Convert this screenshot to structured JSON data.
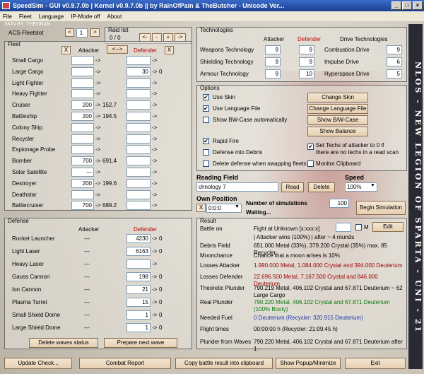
{
  "window": {
    "title": "SpeedSim - GUI v0.9.7.0b | Kernel v0.9.7.0b || by RainOfPain & TheButcher - Unicode Ver..."
  },
  "menu": [
    "File",
    "Fleet",
    "Language",
    "IP-Mode off",
    "About"
  ],
  "skin_label": "SKIN BY: THEORAN",
  "acs": {
    "label": "ACS-Fleetslot",
    "value": "1"
  },
  "raid": {
    "label": "Raid list",
    "value": "0 / 0",
    "btn_prev2": "<-",
    "btn_prev": "-",
    "btn_next": "+",
    "btn_next2": "->"
  },
  "fleet": {
    "title": "Fleet",
    "attacker_label": "Attacker",
    "defender_label": "Defender",
    "swap": "<-->",
    "rows": [
      {
        "name": "Small Cargo",
        "att": "",
        "att_res": "",
        "def": "",
        "def_res": ""
      },
      {
        "name": "Large Cargo",
        "att": "",
        "att_res": "",
        "def": "30",
        "def_res": "0"
      },
      {
        "name": "Light Fighter",
        "att": "",
        "att_res": "",
        "def": "",
        "def_res": ""
      },
      {
        "name": "Heavy Fighter",
        "att": "",
        "att_res": "",
        "def": "",
        "def_res": ""
      },
      {
        "name": "Cruiser",
        "att": "200",
        "att_res": "152.7",
        "def": "",
        "def_res": ""
      },
      {
        "name": "Battleship",
        "att": "200",
        "att_res": "194.5",
        "def": "",
        "def_res": ""
      },
      {
        "name": "Colony Ship",
        "att": "",
        "att_res": "",
        "def": "",
        "def_res": ""
      },
      {
        "name": "Recycler",
        "att": "",
        "att_res": "",
        "def": "",
        "def_res": ""
      },
      {
        "name": "Espionage Probe",
        "att": "",
        "att_res": "",
        "def": "",
        "def_res": ""
      },
      {
        "name": "Bomber",
        "att": "700",
        "att_res": "691.4",
        "def": "",
        "def_res": ""
      },
      {
        "name": "Solar Satellite",
        "att": "---",
        "att_res": "",
        "def": "",
        "def_res": ""
      },
      {
        "name": "Destroyer",
        "att": "200",
        "att_res": "199.6",
        "def": "",
        "def_res": ""
      },
      {
        "name": "Deathstar",
        "att": "",
        "att_res": "",
        "def": "",
        "def_res": ""
      },
      {
        "name": "Battlecruiser",
        "att": "700",
        "att_res": "689.2",
        "def": "",
        "def_res": ""
      }
    ]
  },
  "defense": {
    "title": "Defense",
    "attacker_label": "Attacker",
    "defender_label": "Defender",
    "rows": [
      {
        "name": "Rocket Launcher",
        "att": "---",
        "def": "4230",
        "def_res": "0"
      },
      {
        "name": "Light Laser",
        "att": "---",
        "def": "6163",
        "def_res": "0"
      },
      {
        "name": "Heavy Laser",
        "att": "---",
        "def": "",
        "def_res": ""
      },
      {
        "name": "Gauss Cannon",
        "att": "---",
        "def": "198",
        "def_res": "0"
      },
      {
        "name": "Ion Cannon",
        "att": "---",
        "def": "21",
        "def_res": "0"
      },
      {
        "name": "Plasma Turret",
        "att": "---",
        "def": "15",
        "def_res": "0"
      },
      {
        "name": "Small Shield Dome",
        "att": "---",
        "def": "1",
        "def_res": "0"
      },
      {
        "name": "Large Shield Dome",
        "att": "---",
        "def": "1",
        "def_res": "0"
      }
    ],
    "delete_waves": "Delete waves status",
    "prepare_wave": "Prepare next wave"
  },
  "tech": {
    "title": "Technologies",
    "attacker_label": "Attacker",
    "defender_label": "Defender",
    "drive_label": "Drive Technologies",
    "rows": [
      {
        "name": "Weapons Technology",
        "att": "9",
        "def": "9",
        "drive": "Combustion Drive",
        "drive_val": "9"
      },
      {
        "name": "Shielding Technology",
        "att": "9",
        "def": "9",
        "drive": "Impulse Drive",
        "drive_val": "6"
      },
      {
        "name": "Armour Technology",
        "att": "9",
        "def": "10",
        "drive": "Hyperspace Drive",
        "drive_val": "5"
      }
    ]
  },
  "options": {
    "title": "Options",
    "use_skin": "Use Skin",
    "use_lang": "Use Language File",
    "show_bw": "Show BW-Case automatically",
    "rapid_fire": "Rapid Fire",
    "def_debris": "Defense into Debris",
    "del_def_swap": "Delete defense when swapping fleets",
    "set_techs": "Set Techs of attacker to 0 if",
    "set_techs2": "there are no techs in a read scan",
    "monitor": "Monitor Clipboard",
    "change_skin": "Change Skin",
    "change_lang": "Change Language File",
    "show_bw_btn": "Show B/W-Case",
    "show_balance": "Show Balance",
    "check": "✔"
  },
  "reading": {
    "label": "Reading Field",
    "value": "chnology 7",
    "read": "Read",
    "delete": "Delete",
    "speed_label": "Speed",
    "speed_value": "100%"
  },
  "own_position": {
    "label": "Own Position",
    "value": "0:0:0",
    "x": "X"
  },
  "simulations": {
    "label": "Number of simulations",
    "value": "100",
    "waiting": "Waiting...",
    "begin": "Begin Simulation"
  },
  "result": {
    "title": "Result",
    "m_label": "M",
    "edit": "Edit",
    "rows": [
      {
        "label": "Battle on",
        "value": "Fight at Unknown [x:xxx:x]",
        "cls": ""
      },
      {
        "label": "",
        "value": "| Attacker wins (100%) | after ~ 4 rounds",
        "cls": ""
      },
      {
        "label": "Debris Field",
        "value": "651.000 Metal (33%), 379.200 Crystal (35%) max. 85 Recycler",
        "cls": ""
      },
      {
        "label": "Moonchance",
        "value": "Chance that a moon arises is 10%",
        "cls": ""
      },
      {
        "label": "Losses Attacker",
        "value": "1.990.000 Metal, 1.084.000 Crystal and 394.000 Deuterium",
        "cls": "dark-red"
      },
      {
        "label": "Losses Defender",
        "value": "22.696.500 Metal, 7.167.500 Crystal and 846.000 Deuterium",
        "cls": "dark-red"
      },
      {
        "label": "Theoretic Plunder",
        "value": "790.219 Metal, 406.102 Crystal and 67.871 Deuterium ~ 62 Large Cargo",
        "cls": ""
      },
      {
        "label": "Real Plunder",
        "value": "790.220 Metal, 406.102 Crystal and 67.871 Deuterium (100% Booty)",
        "cls": "green"
      },
      {
        "label": "Needed Fuel",
        "value": "0 Deuterium (Recycler: 320.915 Deuterium)",
        "cls": "blue"
      },
      {
        "label": "Flight times",
        "value": "00:00:00 h (Recycler: 21:09:45 h)",
        "cls": ""
      },
      {
        "label": "Plunder from Waves",
        "value": "790.220 Metal, 406.102 Crystal and 67.871 Deuterium after 1 -",
        "cls": ""
      }
    ]
  },
  "bottom": {
    "update": "Update Check...",
    "combat": "Combat Report",
    "copy": "Copy battle result into clipboard",
    "popup": "Show Popup/Minimize",
    "exit": "Exit"
  },
  "side_banner": "NLOS - NEW LEGION OF SPARTA - UNI - 21"
}
